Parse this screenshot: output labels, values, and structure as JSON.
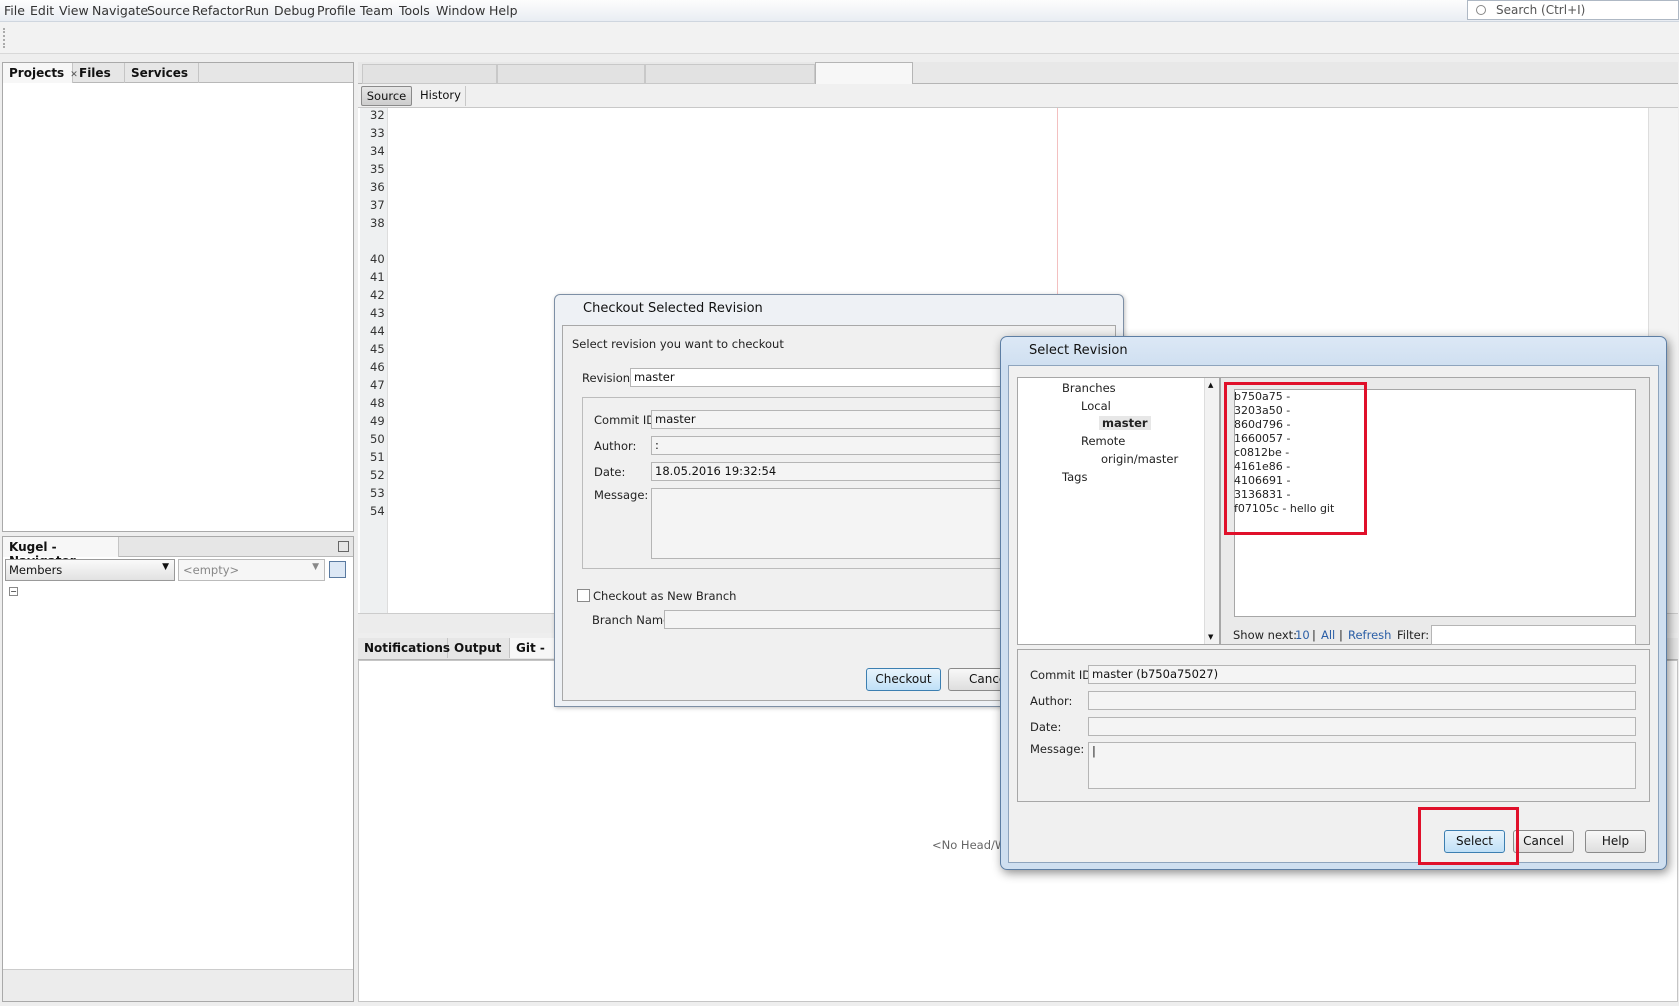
{
  "menu": [
    "File",
    "Edit",
    "View",
    "Navigate",
    "Source",
    "Refactor",
    "Run",
    "Debug",
    "Profile",
    "Team",
    "Tools",
    "Window",
    "Help"
  ],
  "search": {
    "placeholder": "Search (Ctrl+I)"
  },
  "projects_panel": {
    "tabs": [
      "Projects",
      "Files",
      "Services"
    ]
  },
  "navigator": {
    "title": "Kugel - Navigator",
    "members_select": "Members",
    "filter_select": "<empty>"
  },
  "editor": {
    "tabs": [
      "Source",
      "History"
    ],
    "line_numbers": [
      "32",
      "33",
      "34",
      "35",
      "36",
      "37",
      "38",
      "",
      "40",
      "41",
      "42",
      "43",
      "44",
      "45",
      "46",
      "47",
      "48",
      "49",
      "50",
      "51",
      "52",
      "53",
      "54"
    ]
  },
  "output_panel": {
    "tabs": [
      "Notifications",
      "Output",
      "Git -"
    ],
    "status_text": "<No Head/Wo"
  },
  "checkout_dialog": {
    "title": "Checkout Selected Revision",
    "instruction": "Select revision you want to checkout",
    "revision_label": "Revision:",
    "revision_value": "master",
    "commit_id_label": "Commit ID:",
    "commit_id_value": "master",
    "author_label": "Author:",
    "author_value": ":",
    "date_label": "Date:",
    "date_value": "18.05.2016 19:32:54",
    "message_label": "Message:",
    "new_branch_checkbox": "Checkout as New Branch",
    "branch_name_label": "Branch Name:",
    "checkout_button": "Checkout",
    "cancel_button": "Cance"
  },
  "select_dialog": {
    "title": "Select Revision",
    "tree": {
      "branches": "Branches",
      "local": "Local",
      "master": "master",
      "remote": "Remote",
      "origin_master": "origin/master",
      "tags": "Tags"
    },
    "commits": [
      "b750a75 -",
      "3203a50 -",
      "860d796 -",
      "1660057 -",
      "c0812be -",
      "4161e86 -",
      "4106691 -",
      "3136831 -",
      "f07105c - hello git"
    ],
    "show_next_label": "Show next:",
    "show_next_count": "10",
    "sep1": "|",
    "show_all": "All",
    "sep2": "|",
    "refresh": "Refresh",
    "filter_label": "Filter:",
    "commit_id_label": "Commit ID:",
    "commit_id_value": "master (b750a75027)",
    "author_label": "Author:",
    "date_label": "Date:",
    "message_label": "Message:",
    "message_value": "|",
    "select_button": "Select",
    "cancel_button": "Cancel",
    "help_button": "Help"
  }
}
